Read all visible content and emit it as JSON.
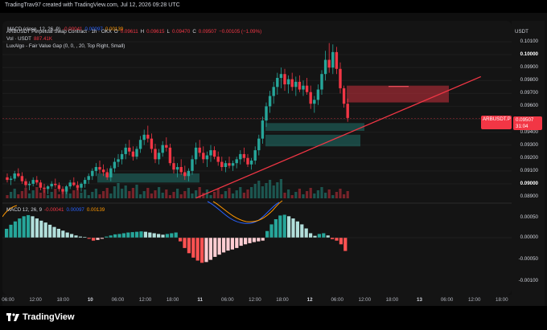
{
  "creator_line": "TradingTrav97 created with TradingView.com, Jul 12, 2026 09:28 UTC",
  "macd_header": {
    "name": "MACD (close, 12, 26, 9)",
    "v1": "-0.00041",
    "v2": "0.00097",
    "v3": "0.00139"
  },
  "main_legend": {
    "symbol": "ARBUSDT Perpetual Swap Contract · 1h · OKX",
    "o_label": "O",
    "o": "0.09611",
    "h_label": "H",
    "h": "0.09615",
    "l_label": "L",
    "l": "0.09470",
    "c_label": "C",
    "c": "0.09507",
    "change": "−0.00105 (−1.09%)",
    "vol_label": "Vol · USDT",
    "vol": "887.41K",
    "luxalgo": "LuxAlgo - Fair Value Gap (0, 0, , 20, Top Right, Small)"
  },
  "macd_pane_label": {
    "name": "MACD 12, 26, 9",
    "v1": "-0.00041",
    "v2": "0.00097",
    "v3": "0.00139"
  },
  "currency": "USDT",
  "price_tag": {
    "symbol": "ARBUSDT.P",
    "price": "0.09507",
    "countdown": "31:04"
  },
  "y_ticks": [
    "0.10100",
    "0.10000",
    "0.09900",
    "0.09800",
    "0.09700",
    "0.09600",
    "0.09400",
    "0.09300",
    "0.09200",
    "0.09100",
    "0.09000",
    "0.08900"
  ],
  "macd_ticks": [
    "0.00050",
    "0.00000",
    "-0.00050",
    "-0.00100"
  ],
  "x_ticks": [
    "06:00",
    "12:00",
    "18:00",
    "10",
    "06:00",
    "12:00",
    "18:00",
    "11",
    "06:00",
    "12:00",
    "18:00",
    "12",
    "06:00",
    "12:00",
    "18:00",
    "13",
    "06:00",
    "12:00",
    "18:00"
  ],
  "footer_logo": "TradingView",
  "colors": {
    "up": "#26a69a",
    "down": "#f23645",
    "trendline": "#f23645",
    "macd_line": "#2962ff",
    "signal_line": "#ff9800"
  },
  "chart_data": {
    "type": "candlestick",
    "symbol": "ARBUSDT.P",
    "interval": "1h",
    "last_price": 0.09507,
    "price_range": [
      0.0888,
      0.1013
    ],
    "candles": [
      [
        0.0905,
        0.0908,
        0.0901,
        0.0903
      ],
      [
        0.0903,
        0.0906,
        0.0899,
        0.0904
      ],
      [
        0.0904,
        0.091,
        0.0902,
        0.0908
      ],
      [
        0.0908,
        0.0912,
        0.0905,
        0.0906
      ],
      [
        0.0906,
        0.0909,
        0.09,
        0.0902
      ],
      [
        0.0902,
        0.0904,
        0.0897,
        0.0899
      ],
      [
        0.0899,
        0.0902,
        0.0895,
        0.09
      ],
      [
        0.09,
        0.0905,
        0.0898,
        0.0903
      ],
      [
        0.0903,
        0.0906,
        0.0899,
        0.0901
      ],
      [
        0.0901,
        0.0903,
        0.0895,
        0.0897
      ],
      [
        0.0897,
        0.09,
        0.0893,
        0.0896
      ],
      [
        0.0896,
        0.0899,
        0.0892,
        0.0898
      ],
      [
        0.0898,
        0.0902,
        0.0896,
        0.09
      ],
      [
        0.09,
        0.0904,
        0.0897,
        0.0899
      ],
      [
        0.0899,
        0.0901,
        0.0894,
        0.0896
      ],
      [
        0.0896,
        0.0898,
        0.0892,
        0.0894
      ],
      [
        0.0894,
        0.0899,
        0.0892,
        0.0898
      ],
      [
        0.0898,
        0.0903,
        0.0896,
        0.0901
      ],
      [
        0.0901,
        0.0905,
        0.0898,
        0.0899
      ],
      [
        0.0899,
        0.0902,
        0.0895,
        0.0897
      ],
      [
        0.0897,
        0.0901,
        0.0894,
        0.09
      ],
      [
        0.09,
        0.0905,
        0.0897,
        0.0903
      ],
      [
        0.0903,
        0.0908,
        0.09,
        0.0906
      ],
      [
        0.0906,
        0.0912,
        0.0903,
        0.091
      ],
      [
        0.091,
        0.0916,
        0.0906,
        0.0913
      ],
      [
        0.0913,
        0.0918,
        0.0908,
        0.0911
      ],
      [
        0.0911,
        0.0915,
        0.0906,
        0.0909
      ],
      [
        0.0909,
        0.0912,
        0.0903,
        0.0905
      ],
      [
        0.0905,
        0.0914,
        0.0902,
        0.0912
      ],
      [
        0.0912,
        0.092,
        0.0909,
        0.0917
      ],
      [
        0.0917,
        0.0923,
        0.0913,
        0.0919
      ],
      [
        0.0919,
        0.0926,
        0.0915,
        0.0923
      ],
      [
        0.0923,
        0.0931,
        0.0919,
        0.0928
      ],
      [
        0.0928,
        0.0934,
        0.0922,
        0.0925
      ],
      [
        0.0925,
        0.0929,
        0.0918,
        0.0921
      ],
      [
        0.0921,
        0.0929,
        0.0919,
        0.0927
      ],
      [
        0.0927,
        0.0937,
        0.0924,
        0.0934
      ],
      [
        0.0934,
        0.0942,
        0.093,
        0.0938
      ],
      [
        0.0938,
        0.0945,
        0.0932,
        0.0935
      ],
      [
        0.0935,
        0.0939,
        0.0924,
        0.0927
      ],
      [
        0.0927,
        0.0931,
        0.0916,
        0.0919
      ],
      [
        0.0919,
        0.0927,
        0.0915,
        0.0924
      ],
      [
        0.0924,
        0.0933,
        0.0921,
        0.093
      ],
      [
        0.093,
        0.0936,
        0.0925,
        0.0928
      ],
      [
        0.0928,
        0.0931,
        0.0914,
        0.0916
      ],
      [
        0.0916,
        0.0921,
        0.0908,
        0.0911
      ],
      [
        0.0911,
        0.0916,
        0.0905,
        0.0913
      ],
      [
        0.0913,
        0.0919,
        0.0907,
        0.0909
      ],
      [
        0.0909,
        0.0914,
        0.0903,
        0.0906
      ],
      [
        0.0906,
        0.0912,
        0.0902,
        0.091
      ],
      [
        0.091,
        0.0922,
        0.0907,
        0.0919
      ],
      [
        0.0919,
        0.0932,
        0.0915,
        0.0928
      ],
      [
        0.0928,
        0.0934,
        0.0921,
        0.0924
      ],
      [
        0.0924,
        0.0929,
        0.0916,
        0.0919
      ],
      [
        0.0919,
        0.0925,
        0.0913,
        0.0922
      ],
      [
        0.0922,
        0.093,
        0.0917,
        0.0926
      ],
      [
        0.0926,
        0.0929,
        0.0919,
        0.0921
      ],
      [
        0.0921,
        0.0925,
        0.0914,
        0.0917
      ],
      [
        0.0917,
        0.0921,
        0.091,
        0.0913
      ],
      [
        0.0913,
        0.0918,
        0.0909,
        0.0916
      ],
      [
        0.0916,
        0.0921,
        0.0912,
        0.0914
      ],
      [
        0.0914,
        0.0918,
        0.091,
        0.0916
      ],
      [
        0.0916,
        0.0921,
        0.0912,
        0.0919
      ],
      [
        0.0919,
        0.0926,
        0.0915,
        0.0923
      ],
      [
        0.0923,
        0.0928,
        0.0917,
        0.092
      ],
      [
        0.092,
        0.0923,
        0.0913,
        0.0915
      ],
      [
        0.0915,
        0.092,
        0.0911,
        0.0918
      ],
      [
        0.0918,
        0.0929,
        0.0915,
        0.0926
      ],
      [
        0.0926,
        0.0938,
        0.0922,
        0.0935
      ],
      [
        0.0935,
        0.0952,
        0.0931,
        0.0949
      ],
      [
        0.0949,
        0.0963,
        0.0944,
        0.096
      ],
      [
        0.096,
        0.0972,
        0.0955,
        0.0968
      ],
      [
        0.0968,
        0.0979,
        0.0962,
        0.0975
      ],
      [
        0.0975,
        0.0986,
        0.0969,
        0.0982
      ],
      [
        0.0982,
        0.099,
        0.0974,
        0.0985
      ],
      [
        0.0985,
        0.0989,
        0.0972,
        0.0977
      ],
      [
        0.0977,
        0.0984,
        0.097,
        0.0981
      ],
      [
        0.0981,
        0.0986,
        0.0972,
        0.0975
      ],
      [
        0.0975,
        0.0983,
        0.0968,
        0.0979
      ],
      [
        0.0979,
        0.0984,
        0.0971,
        0.0973
      ],
      [
        0.0973,
        0.098,
        0.0968,
        0.0976
      ],
      [
        0.0976,
        0.0982,
        0.0969,
        0.0971
      ],
      [
        0.0971,
        0.0976,
        0.0958,
        0.0962
      ],
      [
        0.0962,
        0.0968,
        0.0955,
        0.0965
      ],
      [
        0.0965,
        0.0977,
        0.0961,
        0.0973
      ],
      [
        0.0973,
        0.0988,
        0.0969,
        0.0985
      ],
      [
        0.0985,
        0.1003,
        0.098,
        0.0996
      ],
      [
        0.0996,
        0.1009,
        0.0986,
        0.099
      ],
      [
        0.099,
        0.1008,
        0.0985,
        0.1002
      ],
      [
        0.1002,
        0.1006,
        0.0985,
        0.0989
      ],
      [
        0.0989,
        0.0994,
        0.097,
        0.0974
      ],
      [
        0.0974,
        0.0976,
        0.0959,
        0.0962
      ],
      [
        0.0962,
        0.0966,
        0.0948,
        0.0951
      ]
    ],
    "trendline": {
      "from_candle": 51,
      "from_price": 0.0889,
      "to_candle": 128,
      "to_price": 0.0983
    },
    "fvg_zones": [
      {
        "type": "bearish",
        "price_high": 0.0976,
        "price_low": 0.0963
      },
      {
        "type": "bullish",
        "price_high": 0.0947,
        "price_low": 0.0941
      },
      {
        "type": "bullish",
        "price_high": 0.0938,
        "price_low": 0.0929
      },
      {
        "type": "bullish",
        "price_high": 0.0908,
        "price_low": 0.0901
      }
    ],
    "macd_histogram": [
      0.00024,
      0.00035,
      0.00044,
      0.00052,
      0.00058,
      0.00061,
      0.00058,
      0.00052,
      0.00046,
      0.00041,
      0.00035,
      0.00029,
      0.00024,
      0.00019,
      0.00014,
      0.0001,
      6e-05,
      3e-05,
      2e-05,
      -3e-05,
      -8e-05,
      -6e-05,
      -3e-05,
      3e-05,
      6e-05,
      9e-05,
      0.0001,
      0.00012,
      0.00014,
      0.00015,
      0.00016,
      0.00017,
      0.00016,
      0.00014,
      0.00012,
      0.0001,
      8e-05,
      0.0001,
      0.00012,
      0.00014,
      -0.0001,
      -0.00028,
      -0.00042,
      -0.00054,
      -0.00062,
      -0.00068,
      -0.00066,
      -0.0006,
      -0.00052,
      -0.00046,
      -0.0004,
      -0.00035,
      -0.00032,
      -0.00028,
      -0.00022,
      -0.00018,
      -0.00015,
      -0.00012,
      -0.0001,
      -8e-05,
      0.00018,
      0.00036,
      0.0005,
      0.0006,
      0.00062,
      0.00058,
      0.00052,
      0.00044,
      0.00036,
      0.00025,
      0.00012,
      5e-05,
      0.0001,
      0.00012,
      6e-05,
      -4e-05,
      -8e-05,
      -0.00018,
      -0.00036
    ]
  }
}
